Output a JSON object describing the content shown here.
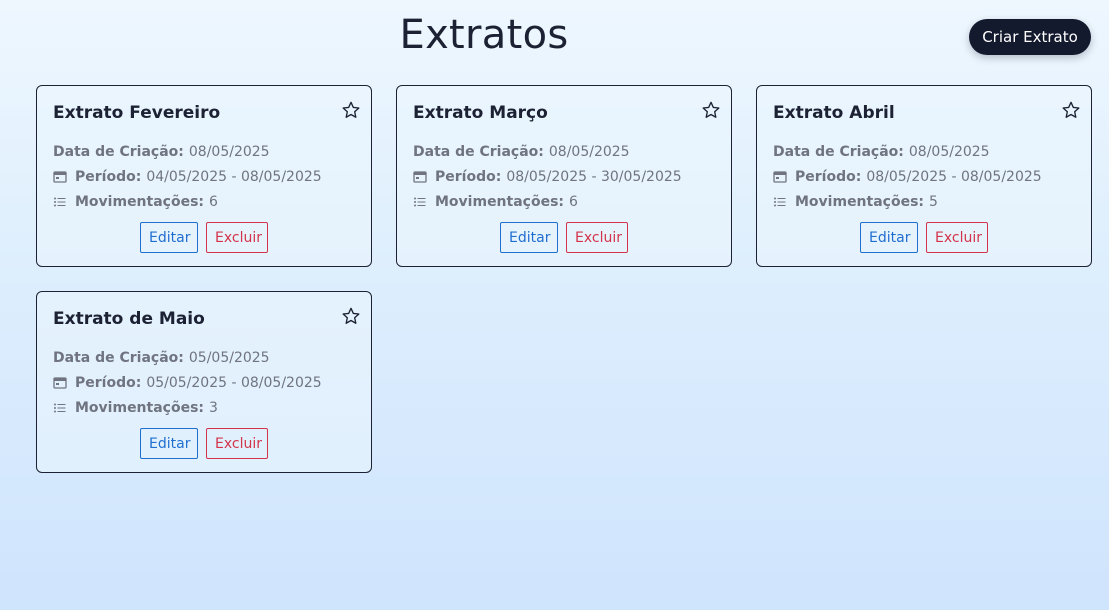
{
  "header": {
    "title": "Extratos",
    "create_label": "Criar Extrato"
  },
  "labels": {
    "created": "Data de Criação:",
    "period": "Período:",
    "movements": "Movimentações:",
    "edit": "Editar",
    "delete": "Excluir"
  },
  "icons": {
    "star": "star-outline-icon",
    "period": "calendar-icon",
    "movements": "list-icon"
  },
  "colors": {
    "primary_dark": "#141a2e",
    "edit": "#1f6fd1",
    "delete": "#d3344a"
  },
  "cards": [
    {
      "title": "Extrato Fevereiro",
      "created": "08/05/2025",
      "period": "04/05/2025 - 08/05/2025",
      "movements": "6",
      "favorite": false
    },
    {
      "title": "Extrato Março",
      "created": "08/05/2025",
      "period": "08/05/2025 - 30/05/2025",
      "movements": "6",
      "favorite": false
    },
    {
      "title": "Extrato Abril",
      "created": "08/05/2025",
      "period": "08/05/2025 - 08/05/2025",
      "movements": "5",
      "favorite": false
    },
    {
      "title": "Extrato de Maio",
      "created": "05/05/2025",
      "period": "05/05/2025 - 08/05/2025",
      "movements": "3",
      "favorite": false
    }
  ]
}
